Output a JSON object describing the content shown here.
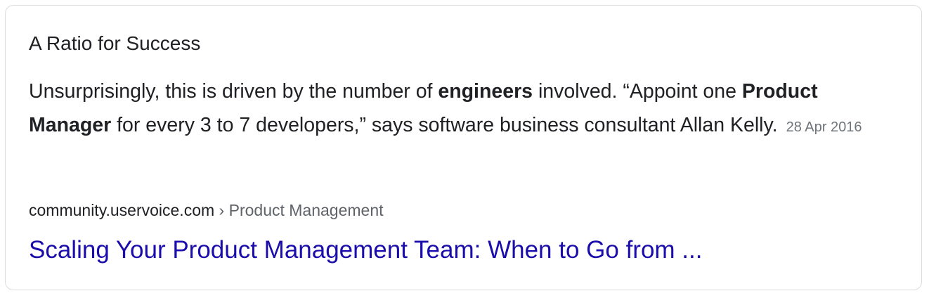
{
  "card": {
    "heading": "A Ratio for Success",
    "snippet": {
      "part1": "Unsurprisingly, this is driven by the number of ",
      "bold1": "engineers",
      "part2": " involved. “Appoint one ",
      "bold2": "Product Manager",
      "part3": " for every 3 to 7 developers,” says software business consultant Allan Kelly.",
      "date": "28 Apr 2016"
    },
    "source": {
      "domain": "community.uservoice.com",
      "separator": " › ",
      "path": "Product Management"
    },
    "result_title": "Scaling Your Product Management Team: When to Go from ..."
  },
  "colors": {
    "link": "#1a0dab",
    "text": "#202124",
    "muted": "#70757a",
    "border": "#dadce0"
  }
}
